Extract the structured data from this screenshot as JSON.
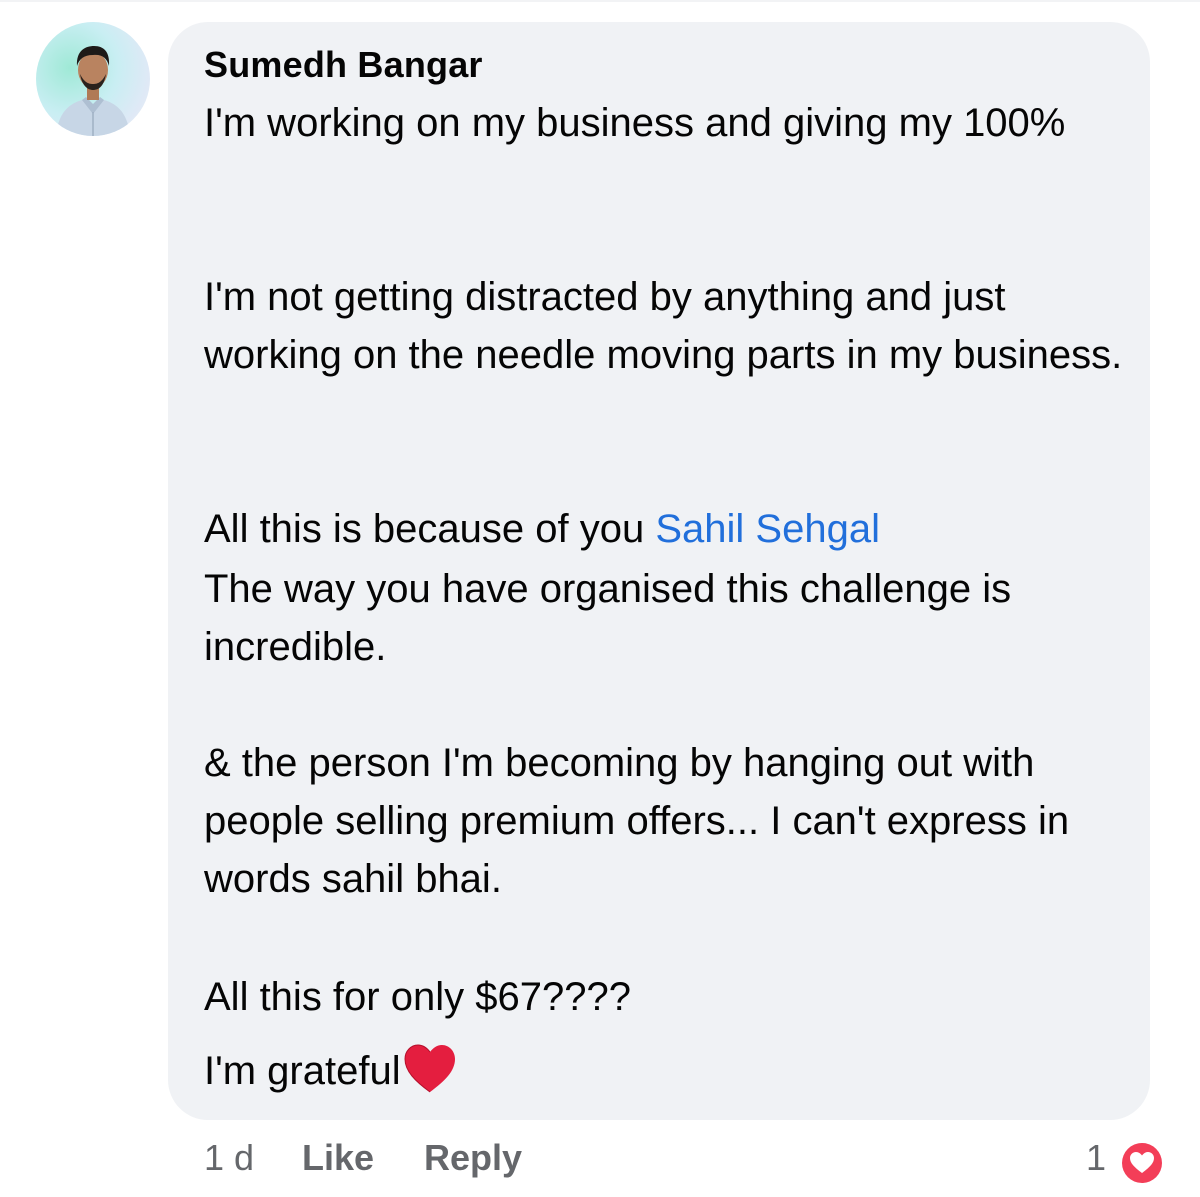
{
  "comment": {
    "author": "Sumedh Bangar",
    "paragraphs": [
      "I'm working on my business and giving my 100%",
      "I'm not getting distracted by anything and just working on the needle moving parts in my business.",
      "The way you have organised this challenge is incredible.",
      "& the person I'm becoming by hanging out with people selling premium offers... I can't express in words sahil bhai.",
      "All this for only $67????",
      "I'm grateful"
    ],
    "mention_prefix": "All this is because of you ",
    "mention_name": "Sahil Sehgal",
    "heart_emoji_icon": "red-heart-icon"
  },
  "actions": {
    "time": "1 d",
    "like": "Like",
    "reply": "Reply",
    "reaction_count": "1",
    "reaction_icon": "love-reaction-icon"
  },
  "colors": {
    "bubble": "#f0f2f5",
    "text": "#050505",
    "mention": "#216fdb",
    "secondary": "#65676b",
    "heart": "#e41e3f"
  }
}
